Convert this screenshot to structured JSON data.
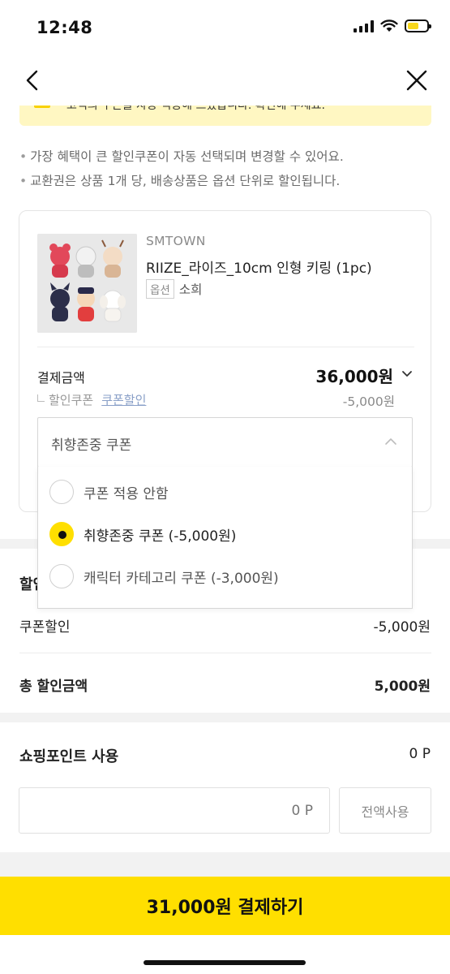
{
  "status_bar": {
    "time": "12:48"
  },
  "notice": {
    "text": "고객의 쿠폰을 자동 적용해 드렸습니다. 확인해 주세요."
  },
  "info": {
    "line1": "가장 혜택이 큰 할인쿠폰이 자동 선택되며 변경할 수 있어요.",
    "line2": "교환권은 상품 1개 당, 배송상품은 옵션 단위로 할인됩니다.",
    "bullet": "•"
  },
  "product": {
    "brand": "SMTOWN",
    "name": "RIIZE_라이즈_10cm 인형 키링 (1pc)",
    "option_tag": "옵션",
    "option_value": "소희",
    "pay_label": "결제금액",
    "pay_amount": "36,000원",
    "coupon_label": "할인쿠폰",
    "coupon_link": "쿠폰할인",
    "coupon_discount": "-5,000원"
  },
  "coupon_select": {
    "selected": "취향존중 쿠폰",
    "options": [
      {
        "label": "쿠폰 적용 안함",
        "checked": false
      },
      {
        "label": "취향존중 쿠폰 (-5,000원)",
        "checked": true
      },
      {
        "label": "캐릭터 카테고리 쿠폰 (-3,000원)",
        "checked": false
      }
    ]
  },
  "discount_section": {
    "title_partial": "할인",
    "coupon_row_label": "쿠폰할인",
    "coupon_row_value": "-5,000원",
    "total_label": "총 할인금액",
    "total_value": "5,000원"
  },
  "points": {
    "label": "쇼핑포인트 사용",
    "value": "0 P",
    "input_placeholder": "0 P",
    "use_all_label": "전액사용"
  },
  "pay_button": {
    "label": "31,000원 결제하기"
  },
  "colors": {
    "accent": "#ffdf00",
    "notice_bg": "#fff7c2"
  },
  "icons": {
    "back": "chevron-left-icon",
    "close": "close-icon"
  }
}
